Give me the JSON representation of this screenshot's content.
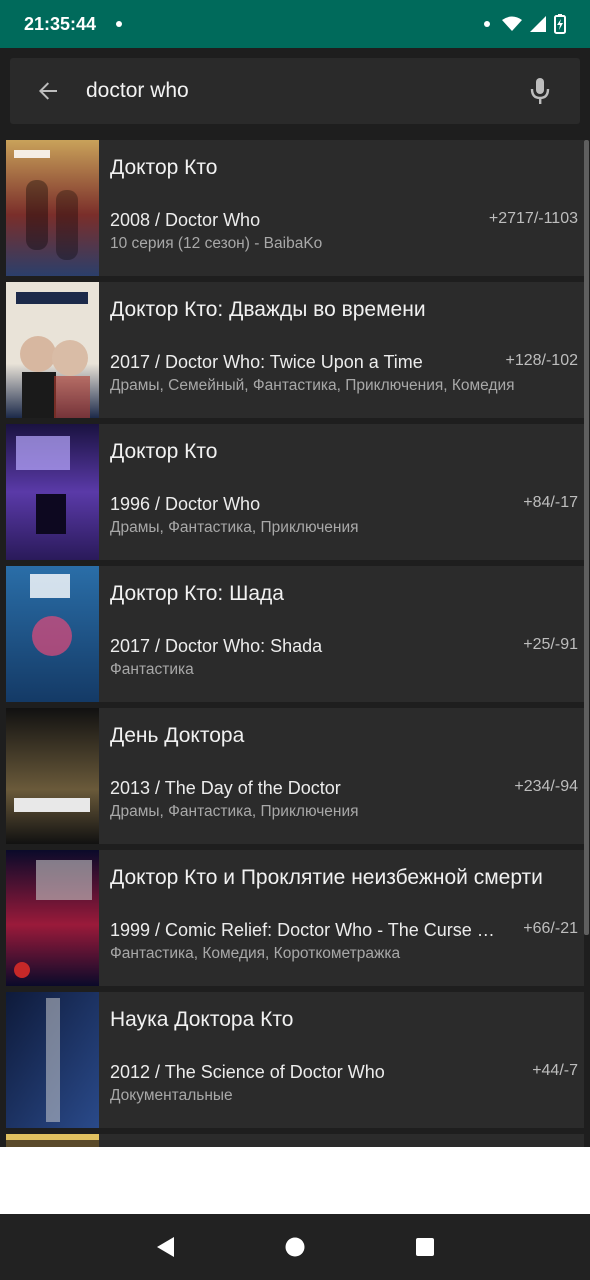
{
  "status_bar": {
    "time": "21:35:44"
  },
  "search": {
    "query": "doctor who"
  },
  "results": [
    {
      "title": "Доктор Кто",
      "subtitle": "2008 / Doctor Who",
      "votes": "+2717/-1103",
      "details": "10 серия (12 сезон) - BaibaKo",
      "poster_colors": [
        "#c9a25a",
        "#7a2e2a",
        "#2b3f6b"
      ]
    },
    {
      "title": "Доктор Кто: Дважды во времени",
      "subtitle": "2017 / Doctor Who: Twice Upon a Time",
      "votes": "+128/-102",
      "details": "Драмы, Семейный, Фантастика, Приключения, Комедия",
      "poster_colors": [
        "#e9e3d8",
        "#1c2a4a",
        "#b33a2f"
      ]
    },
    {
      "title": "Доктор Кто",
      "subtitle": "1996 / Doctor Who",
      "votes": "+84/-17",
      "details": "Драмы, Фантастика, Приключения",
      "poster_colors": [
        "#1a1240",
        "#5a3aa8",
        "#2a1a5a"
      ]
    },
    {
      "title": "Доктор Кто: Шада",
      "subtitle": "2017 / Doctor Who: Shada",
      "votes": "+25/-91",
      "details": "Фантастика",
      "poster_colors": [
        "#2a6ea8",
        "#e24a7a",
        "#143a66"
      ]
    },
    {
      "title": "День Доктора",
      "subtitle": "2013 / The Day of the Doctor",
      "votes": "+234/-94",
      "details": "Драмы, Фантастика, Приключения",
      "poster_colors": [
        "#111111",
        "#6a5a3a",
        "#e8e8e8"
      ]
    },
    {
      "title": "Доктор Кто и Проклятие неизбежной смерти",
      "subtitle": "1999 / Comic Relief: Doctor Who - The Curse …",
      "votes": "+66/-21",
      "details": "Фантастика, Комедия, Короткометражка",
      "poster_colors": [
        "#0a0a2a",
        "#9a1a3a",
        "#c8c8c8"
      ]
    },
    {
      "title": "Наука Доктора Кто",
      "subtitle": "2012 / The Science of Doctor Who",
      "votes": "+44/-7",
      "details": "Документальные",
      "poster_colors": [
        "#0e1a3a",
        "#2a4a8a",
        "#d8d8d8"
      ]
    }
  ],
  "colors": {
    "status_bar": "#006a5b",
    "background": "#1e1e1e",
    "card": "#2b2b2b"
  }
}
